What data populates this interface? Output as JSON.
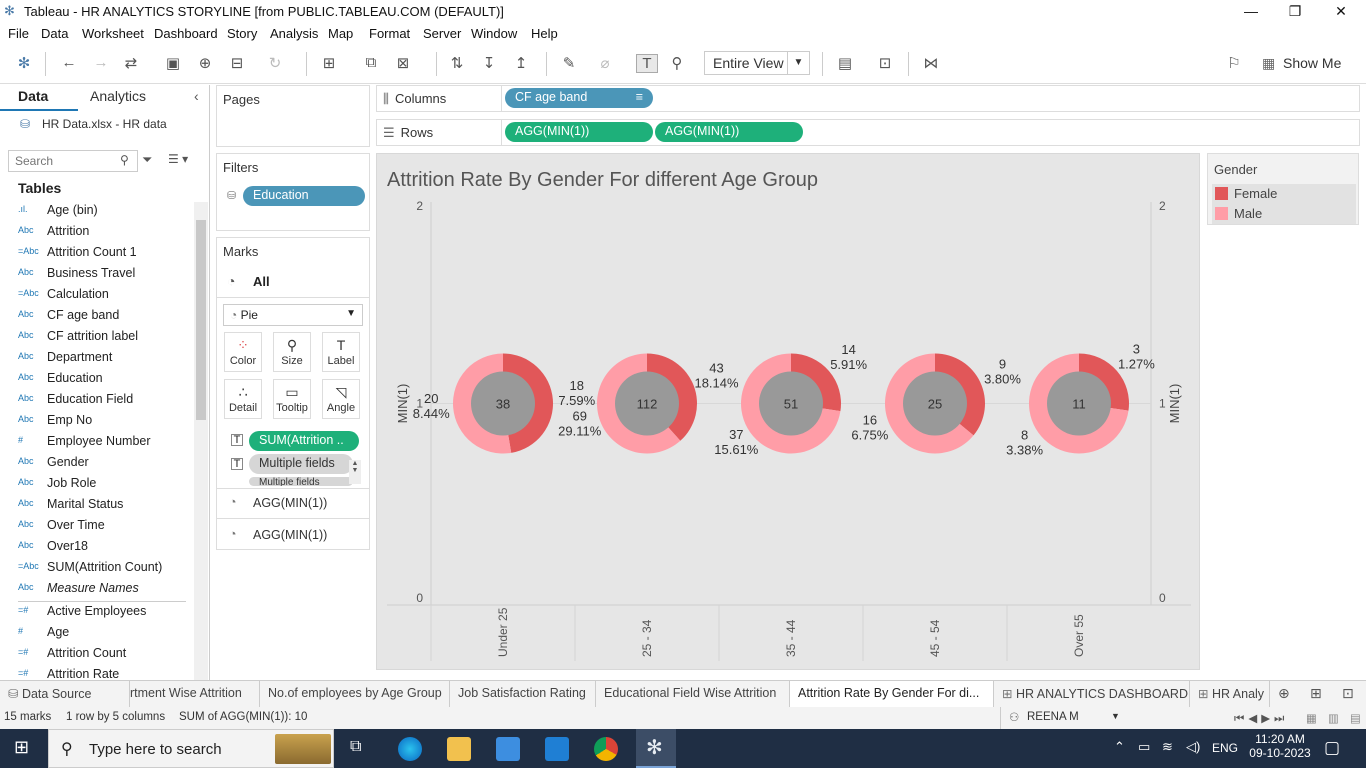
{
  "window": {
    "title": "Tableau - HR ANALYTICS STORYLINE [from PUBLIC.TABLEAU.COM (DEFAULT)]"
  },
  "menu": [
    "File",
    "Data",
    "Worksheet",
    "Dashboard",
    "Story",
    "Analysis",
    "Map",
    "Format",
    "Server",
    "Window",
    "Help"
  ],
  "toolbar": {
    "view_mode": "Entire View",
    "show_me": "Show Me"
  },
  "datapane": {
    "tab_data": "Data",
    "tab_analytics": "Analytics",
    "source": "HR Data.xlsx - HR data",
    "search_placeholder": "Search",
    "tables_heading": "Tables",
    "fields": [
      {
        "icon": ".ıl.",
        "name": "Age (bin)"
      },
      {
        "icon": "Abc",
        "name": "Attrition"
      },
      {
        "icon": "=Abc",
        "name": "Attrition Count 1"
      },
      {
        "icon": "Abc",
        "name": "Business Travel"
      },
      {
        "icon": "=Abc",
        "name": "Calculation"
      },
      {
        "icon": "Abc",
        "name": "CF age band"
      },
      {
        "icon": "Abc",
        "name": "CF attrition label"
      },
      {
        "icon": "Abc",
        "name": "Department"
      },
      {
        "icon": "Abc",
        "name": "Education"
      },
      {
        "icon": "Abc",
        "name": "Education Field"
      },
      {
        "icon": "Abc",
        "name": "Emp No"
      },
      {
        "icon": "#",
        "name": "Employee Number"
      },
      {
        "icon": "Abc",
        "name": "Gender"
      },
      {
        "icon": "Abc",
        "name": "Job Role"
      },
      {
        "icon": "Abc",
        "name": "Marital Status"
      },
      {
        "icon": "Abc",
        "name": "Over Time"
      },
      {
        "icon": "Abc",
        "name": "Over18"
      },
      {
        "icon": "=Abc",
        "name": "SUM(Attrition Count)"
      },
      {
        "icon": "Abc",
        "name": "Measure Names"
      },
      {
        "icon": "=#",
        "name": "Active Employees"
      },
      {
        "icon": "#",
        "name": "Age"
      },
      {
        "icon": "=#",
        "name": "Attrition Count"
      },
      {
        "icon": "=#",
        "name": "Attrition Rate"
      }
    ]
  },
  "pages": {
    "label": "Pages"
  },
  "filters": {
    "label": "Filters",
    "items": [
      "Education"
    ]
  },
  "marks": {
    "label": "Marks",
    "all": "All",
    "mark_type": "Pie",
    "buttons": [
      "Color",
      "Size",
      "Label",
      "Detail",
      "Tooltip",
      "Angle"
    ],
    "fields": [
      "SUM(Attrition ..",
      "Multiple fields",
      "Multiple fields"
    ],
    "layers": [
      "AGG(MIN(1))",
      "AGG(MIN(1))"
    ]
  },
  "shelves": {
    "columns_label": "Columns",
    "columns": [
      "CF age band"
    ],
    "rows_label": "Rows",
    "rows": [
      "AGG(MIN(1))",
      "AGG(MIN(1))"
    ]
  },
  "legend": {
    "title": "Gender",
    "items": [
      {
        "name": "Female",
        "color": "#e15759"
      },
      {
        "name": "Male",
        "color": "#ff9da7"
      }
    ]
  },
  "chart_data": {
    "type": "donut",
    "title": "Attrition Rate By Gender For different Age Group",
    "ylabel": "MIN(1)",
    "ylabel_right": "MIN(1)",
    "yticks": [
      "0",
      "1",
      "2"
    ],
    "ylim": [
      0,
      2
    ],
    "categories": [
      "Under 25",
      "25 - 34",
      "35 - 44",
      "45 - 54",
      "Over 55"
    ],
    "totals": [
      38,
      112,
      51,
      25,
      11
    ],
    "series": [
      {
        "name": "Female",
        "color": "#e15759",
        "values": [
          18,
          43,
          14,
          9,
          3
        ],
        "labels": [
          "7.59%",
          "18.14%",
          "5.91%",
          "3.80%",
          "1.27%"
        ]
      },
      {
        "name": "Male",
        "color": "#ff9da7",
        "values": [
          20,
          69,
          37,
          16,
          8
        ],
        "labels": [
          "8.44%",
          "29.11%",
          "15.61%",
          "6.75%",
          "3.38%"
        ]
      }
    ],
    "center_color": "#999999"
  },
  "sheets": [
    {
      "name": "Data Source",
      "icon": "cylinder"
    },
    {
      "name": "rtment Wise Attrition"
    },
    {
      "name": "No.of employees by Age Group"
    },
    {
      "name": "Job Satisfaction Rating"
    },
    {
      "name": "Educational Field Wise Attrition"
    },
    {
      "name": "Attrition Rate By Gender For di...",
      "active": true
    },
    {
      "name": "HR ANALYTICS DASHBOARD"
    },
    {
      "name": "HR Analy"
    }
  ],
  "status": {
    "marks": "15 marks",
    "rows": "1 row by 5 columns",
    "sum": "SUM of AGG(MIN(1)): 10",
    "user": "REENA M"
  },
  "taskbar": {
    "search": "Type here to search",
    "lang": "ENG",
    "time": "11:20 AM",
    "date": "09-10-2023"
  }
}
